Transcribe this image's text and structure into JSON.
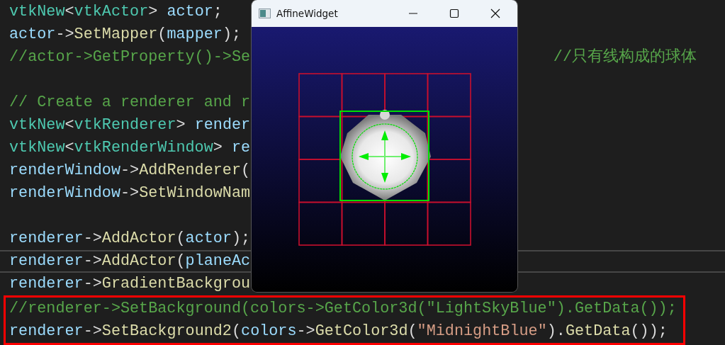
{
  "code": {
    "lines": [
      {
        "current": false,
        "marked": false,
        "tokens": [
          {
            "kind": "type",
            "text": "vtkNew"
          },
          {
            "kind": "punct",
            "text": "<"
          },
          {
            "kind": "type",
            "text": "vtkActor"
          },
          {
            "kind": "punct",
            "text": "> "
          },
          {
            "kind": "var",
            "text": "actor"
          },
          {
            "kind": "punct",
            "text": ";"
          }
        ]
      },
      {
        "current": false,
        "marked": false,
        "tokens": [
          {
            "kind": "var",
            "text": "actor"
          },
          {
            "kind": "punct",
            "text": "->"
          },
          {
            "kind": "func",
            "text": "SetMapper"
          },
          {
            "kind": "punct",
            "text": "("
          },
          {
            "kind": "var",
            "text": "mapper"
          },
          {
            "kind": "punct",
            "text": ");"
          }
        ]
      },
      {
        "current": false,
        "marked": false,
        "tokens": [
          {
            "kind": "comment",
            "text": "//actor->GetProperty()->Se"
          }
        ],
        "trailing_comment": "//只有线构成的球体"
      },
      {
        "current": false,
        "marked": false
      },
      {
        "current": false,
        "marked": false,
        "tokens": [
          {
            "kind": "comment",
            "text": "// Create a renderer and r"
          }
        ]
      },
      {
        "current": false,
        "marked": false,
        "tokens": [
          {
            "kind": "type",
            "text": "vtkNew"
          },
          {
            "kind": "punct",
            "text": "<"
          },
          {
            "kind": "type",
            "text": "vtkRenderer"
          },
          {
            "kind": "punct",
            "text": "> "
          },
          {
            "kind": "var",
            "text": "render"
          }
        ]
      },
      {
        "current": false,
        "marked": false,
        "tokens": [
          {
            "kind": "type",
            "text": "vtkNew"
          },
          {
            "kind": "punct",
            "text": "<"
          },
          {
            "kind": "type",
            "text": "vtkRenderWindow"
          },
          {
            "kind": "punct",
            "text": "> "
          },
          {
            "kind": "var",
            "text": "re"
          }
        ]
      },
      {
        "current": false,
        "marked": false,
        "tokens": [
          {
            "kind": "var",
            "text": "renderWindow"
          },
          {
            "kind": "punct",
            "text": "->"
          },
          {
            "kind": "func",
            "text": "AddRenderer"
          },
          {
            "kind": "punct",
            "text": "("
          }
        ]
      },
      {
        "current": false,
        "marked": false,
        "tokens": [
          {
            "kind": "var",
            "text": "renderWindow"
          },
          {
            "kind": "punct",
            "text": "->"
          },
          {
            "kind": "func",
            "text": "SetWindowNam"
          }
        ]
      },
      {
        "current": false,
        "marked": false
      },
      {
        "current": false,
        "marked": false,
        "tokens": [
          {
            "kind": "var",
            "text": "renderer"
          },
          {
            "kind": "punct",
            "text": "->"
          },
          {
            "kind": "func",
            "text": "AddActor"
          },
          {
            "kind": "punct",
            "text": "("
          },
          {
            "kind": "var",
            "text": "actor"
          },
          {
            "kind": "punct",
            "text": ");"
          }
        ]
      },
      {
        "current": true,
        "marked": false,
        "tokens": [
          {
            "kind": "var",
            "text": "renderer"
          },
          {
            "kind": "punct",
            "text": "->"
          },
          {
            "kind": "func",
            "text": "AddActor"
          },
          {
            "kind": "punct",
            "text": "("
          },
          {
            "kind": "var",
            "text": "planeAc"
          }
        ]
      },
      {
        "current": false,
        "marked": false,
        "tokens": [
          {
            "kind": "var",
            "text": "renderer"
          },
          {
            "kind": "punct",
            "text": "->"
          },
          {
            "kind": "func",
            "text": "GradientBackgrou"
          }
        ]
      },
      {
        "current": false,
        "marked": true,
        "tokens": [
          {
            "kind": "comment",
            "text": "//renderer->SetBackground(colors->GetColor3d(\"LightSkyBlue\").GetData());"
          }
        ]
      },
      {
        "current": false,
        "marked": true,
        "tokens": [
          {
            "kind": "var",
            "text": "renderer"
          },
          {
            "kind": "punct",
            "text": "->"
          },
          {
            "kind": "func",
            "text": "SetBackground2"
          },
          {
            "kind": "punct",
            "text": "("
          },
          {
            "kind": "var",
            "text": "colors"
          },
          {
            "kind": "punct",
            "text": "->"
          },
          {
            "kind": "func",
            "text": "GetColor3d"
          },
          {
            "kind": "punct",
            "text": "("
          },
          {
            "kind": "string",
            "text": "\"MidnightBlue\""
          },
          {
            "kind": "punct",
            "text": ")."
          },
          {
            "kind": "func",
            "text": "GetData"
          },
          {
            "kind": "punct",
            "text": "());"
          }
        ]
      }
    ]
  },
  "window": {
    "title": "AffineWidget"
  }
}
